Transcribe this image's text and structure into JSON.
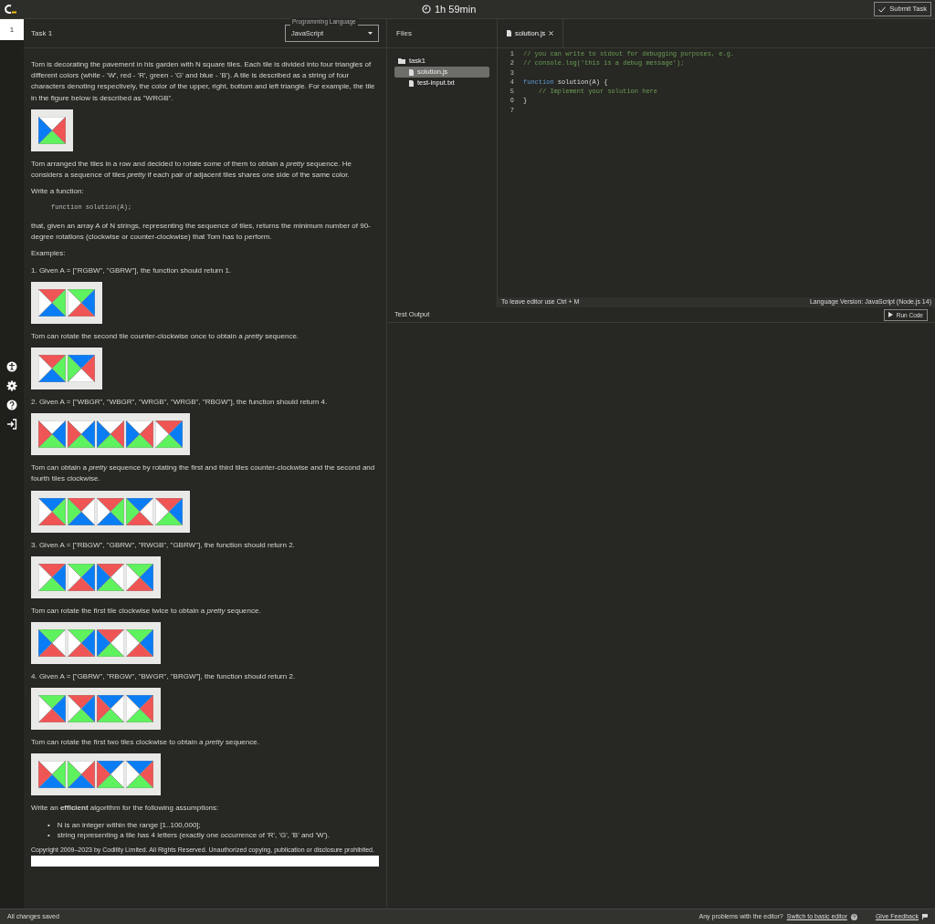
{
  "top_bar": {
    "timer": "1h 59min",
    "submit_button": "Submit Task"
  },
  "task_nav": [
    {
      "label": "1",
      "selected": true
    }
  ],
  "task": {
    "title": "Task 1",
    "language_label": "Programming Language",
    "language": "JavaScript"
  },
  "problem": [
    {
      "kind": "para",
      "text": "Tom is decorating the pavement in his garden with N square tiles. Each tile is divided into four triangles of different colors (white - 'W', red - 'R', green - 'G' and blue - 'B'). A tile is described as a string of four characters denoting respectively, the color of the upper, right, bottom and left triangle. For example, the tile in the figure below is described as \"WRGB\"."
    },
    {
      "kind": "tiles",
      "tiles": [
        {
          "triangles": [
            {
              "color": "#ffffff"
            },
            {
              "color": "#f05555"
            },
            {
              "color": "#5ef25e"
            },
            {
              "color": "#0a7df5"
            }
          ]
        }
      ]
    },
    {
      "kind": "para",
      "text": "Tom arranged the tiles in a row and decided to rotate some of them to obtain a *pretty* sequence. He considers a sequence of tiles *pretty* if each pair of adjacent tiles shares one side of the same color."
    },
    {
      "kind": "para",
      "text": "Write a function:"
    },
    {
      "kind": "code",
      "text": "function solution(A);"
    },
    {
      "kind": "para",
      "text": "that, given an array A of N strings, representing the sequence of tiles, returns the minimum number of 90-degree rotations (clockwise or counter-clockwise) that Tom has to perform."
    },
    {
      "kind": "para",
      "text": "Examples:"
    },
    {
      "kind": "para",
      "text": "1. Given A = [\"RGBW\", \"GBRW\"], the function should return 1."
    },
    {
      "kind": "tiles",
      "tiles": [
        {
          "triangles": [
            {
              "color": "#f05555"
            },
            {
              "color": "#5ef25e"
            },
            {
              "color": "#0a7df5"
            },
            {
              "color": "#ffffff"
            }
          ]
        },
        {
          "triangles": [
            {
              "color": "#5ef25e"
            },
            {
              "color": "#0a7df5"
            },
            {
              "color": "#f05555"
            },
            {
              "color": "#ffffff"
            }
          ]
        }
      ]
    },
    {
      "kind": "para",
      "text": "Tom can rotate the second tile counter-clockwise once to obtain a *pretty* sequence."
    },
    {
      "kind": "tiles",
      "tiles": [
        {
          "triangles": [
            {
              "color": "#f05555"
            },
            {
              "color": "#5ef25e"
            },
            {
              "color": "#0a7df5"
            },
            {
              "color": "#ffffff"
            }
          ]
        },
        {
          "triangles": [
            {
              "color": "#0a7df5"
            },
            {
              "color": "#f05555"
            },
            {
              "color": "#ffffff"
            },
            {
              "color": "#5ef25e"
            }
          ]
        }
      ]
    },
    {
      "kind": "para",
      "text": "2. Given A = [\"WBGR\", \"WBGR\", \"WRGB\", \"WRGB\", \"RBGW\"], the function should return 4."
    },
    {
      "kind": "tiles",
      "tiles": [
        {
          "triangles": [
            {
              "color": "#ffffff"
            },
            {
              "color": "#0a7df5"
            },
            {
              "color": "#5ef25e"
            },
            {
              "color": "#f05555"
            }
          ]
        },
        {
          "triangles": [
            {
              "color": "#ffffff"
            },
            {
              "color": "#0a7df5"
            },
            {
              "color": "#5ef25e"
            },
            {
              "color": "#f05555"
            }
          ]
        },
        {
          "triangles": [
            {
              "color": "#ffffff"
            },
            {
              "color": "#f05555"
            },
            {
              "color": "#5ef25e"
            },
            {
              "color": "#0a7df5"
            }
          ]
        },
        {
          "triangles": [
            {
              "color": "#ffffff"
            },
            {
              "color": "#f05555"
            },
            {
              "color": "#5ef25e"
            },
            {
              "color": "#0a7df5"
            }
          ]
        },
        {
          "triangles": [
            {
              "color": "#f05555"
            },
            {
              "color": "#0a7df5"
            },
            {
              "color": "#5ef25e"
            },
            {
              "color": "#ffffff"
            }
          ]
        }
      ]
    },
    {
      "kind": "para",
      "text": "Tom can obtain a *pretty* sequence by rotating the first and third tiles counter-clockwise and the second and fourth tiles clockwise."
    },
    {
      "kind": "tiles",
      "tiles": [
        {
          "triangles": [
            {
              "color": "#0a7df5"
            },
            {
              "color": "#5ef25e"
            },
            {
              "color": "#f05555"
            },
            {
              "color": "#ffffff"
            }
          ]
        },
        {
          "triangles": [
            {
              "color": "#f05555"
            },
            {
              "color": "#ffffff"
            },
            {
              "color": "#0a7df5"
            },
            {
              "color": "#5ef25e"
            }
          ]
        },
        {
          "triangles": [
            {
              "color": "#f05555"
            },
            {
              "color": "#5ef25e"
            },
            {
              "color": "#0a7df5"
            },
            {
              "color": "#ffffff"
            }
          ]
        },
        {
          "triangles": [
            {
              "color": "#0a7df5"
            },
            {
              "color": "#ffffff"
            },
            {
              "color": "#f05555"
            },
            {
              "color": "#5ef25e"
            }
          ]
        },
        {
          "triangles": [
            {
              "color": "#f05555"
            },
            {
              "color": "#0a7df5"
            },
            {
              "color": "#5ef25e"
            },
            {
              "color": "#ffffff"
            }
          ]
        }
      ]
    },
    {
      "kind": "para",
      "text": "3. Given A = [\"RBGW\", \"GBRW\", \"RWGB\", \"GBRW\"], the function should return 2."
    },
    {
      "kind": "tiles",
      "tiles": [
        {
          "triangles": [
            {
              "color": "#f05555"
            },
            {
              "color": "#0a7df5"
            },
            {
              "color": "#5ef25e"
            },
            {
              "color": "#ffffff"
            }
          ]
        },
        {
          "triangles": [
            {
              "color": "#5ef25e"
            },
            {
              "color": "#0a7df5"
            },
            {
              "color": "#f05555"
            },
            {
              "color": "#ffffff"
            }
          ]
        },
        {
          "triangles": [
            {
              "color": "#f05555"
            },
            {
              "color": "#ffffff"
            },
            {
              "color": "#5ef25e"
            },
            {
              "color": "#0a7df5"
            }
          ]
        },
        {
          "triangles": [
            {
              "color": "#5ef25e"
            },
            {
              "color": "#0a7df5"
            },
            {
              "color": "#f05555"
            },
            {
              "color": "#ffffff"
            }
          ]
        }
      ]
    },
    {
      "kind": "para",
      "text": "Tom can rotate the first tile clockwise twice to obtain a *pretty* sequence."
    },
    {
      "kind": "tiles",
      "tiles": [
        {
          "triangles": [
            {
              "color": "#5ef25e"
            },
            {
              "color": "#ffffff"
            },
            {
              "color": "#f05555"
            },
            {
              "color": "#0a7df5"
            }
          ]
        },
        {
          "triangles": [
            {
              "color": "#5ef25e"
            },
            {
              "color": "#0a7df5"
            },
            {
              "color": "#f05555"
            },
            {
              "color": "#ffffff"
            }
          ]
        },
        {
          "triangles": [
            {
              "color": "#f05555"
            },
            {
              "color": "#ffffff"
            },
            {
              "color": "#5ef25e"
            },
            {
              "color": "#0a7df5"
            }
          ]
        },
        {
          "triangles": [
            {
              "color": "#5ef25e"
            },
            {
              "color": "#0a7df5"
            },
            {
              "color": "#f05555"
            },
            {
              "color": "#ffffff"
            }
          ]
        }
      ]
    },
    {
      "kind": "para",
      "text": "4. Given A = [\"GBRW\", \"RBGW\", \"BWGR\", \"BRGW\"], the function should return 2."
    },
    {
      "kind": "tiles",
      "tiles": [
        {
          "triangles": [
            {
              "color": "#5ef25e"
            },
            {
              "color": "#0a7df5"
            },
            {
              "color": "#f05555"
            },
            {
              "color": "#ffffff"
            }
          ]
        },
        {
          "triangles": [
            {
              "color": "#f05555"
            },
            {
              "color": "#0a7df5"
            },
            {
              "color": "#5ef25e"
            },
            {
              "color": "#ffffff"
            }
          ]
        },
        {
          "triangles": [
            {
              "color": "#0a7df5"
            },
            {
              "color": "#ffffff"
            },
            {
              "color": "#5ef25e"
            },
            {
              "color": "#f05555"
            }
          ]
        },
        {
          "triangles": [
            {
              "color": "#0a7df5"
            },
            {
              "color": "#f05555"
            },
            {
              "color": "#5ef25e"
            },
            {
              "color": "#ffffff"
            }
          ]
        }
      ]
    },
    {
      "kind": "para",
      "text": "Tom can rotate the first two tiles clockwise to obtain a *pretty* sequence."
    },
    {
      "kind": "tiles",
      "tiles": [
        {
          "triangles": [
            {
              "color": "#ffffff"
            },
            {
              "color": "#5ef25e"
            },
            {
              "color": "#0a7df5"
            },
            {
              "color": "#f05555"
            }
          ]
        },
        {
          "triangles": [
            {
              "color": "#ffffff"
            },
            {
              "color": "#f05555"
            },
            {
              "color": "#0a7df5"
            },
            {
              "color": "#5ef25e"
            }
          ]
        },
        {
          "triangles": [
            {
              "color": "#0a7df5"
            },
            {
              "color": "#ffffff"
            },
            {
              "color": "#5ef25e"
            },
            {
              "color": "#f05555"
            }
          ]
        },
        {
          "triangles": [
            {
              "color": "#0a7df5"
            },
            {
              "color": "#f05555"
            },
            {
              "color": "#5ef25e"
            },
            {
              "color": "#ffffff"
            }
          ]
        }
      ]
    },
    {
      "kind": "para",
      "text": "Write an **efficient** algorithm for the following assumptions:"
    },
    {
      "kind": "bullets",
      "marker": "•",
      "items": [
        "N is an integer within the range [1..100,000];",
        "string representing a tile has 4 letters (exactly one occurrence of 'R', 'G', 'B' and 'W')."
      ]
    },
    {
      "kind": "copyright",
      "text": "Copyright 2009–2023 by Codility Limited. All Rights Reserved. Unauthorized copying, publication or disclosure prohibited."
    }
  ],
  "files": {
    "title": "Files",
    "tree": [
      {
        "name": "task1",
        "kind": "folder",
        "children": [
          {
            "name": "solution.js",
            "kind": "file",
            "selected": true
          },
          {
            "name": "test-input.txt",
            "kind": "file",
            "selected": false
          }
        ]
      }
    ]
  },
  "editor": {
    "tab": "solution.js",
    "lines": [
      {
        "number": "1",
        "code": "// you can write to stdout for debugging purposes, e.g.",
        "kind": "comment"
      },
      {
        "number": "2",
        "code": "// console.log('this is a debug message');",
        "kind": "comment"
      },
      {
        "number": "3"
      },
      {
        "number": "4",
        "code": "function solution(A) {",
        "kind": "function"
      },
      {
        "number": "5",
        "code": "    // Implement your solution here",
        "kind": "comment"
      },
      {
        "number": "6",
        "code": "}",
        "kind": "plain"
      },
      {
        "number": "7"
      }
    ],
    "hint": "To leave editor use Ctrl + M",
    "version": "Language Version: JavaScript (Node.js 14)"
  },
  "test_output": {
    "title": "Test Output",
    "run_button": "Run Code"
  },
  "status_bar": {
    "saved": "All changes saved",
    "problem_text": "Any problems with the editor?",
    "switch_link": "Switch to basic editor",
    "feedback": "Give Feedback"
  }
}
